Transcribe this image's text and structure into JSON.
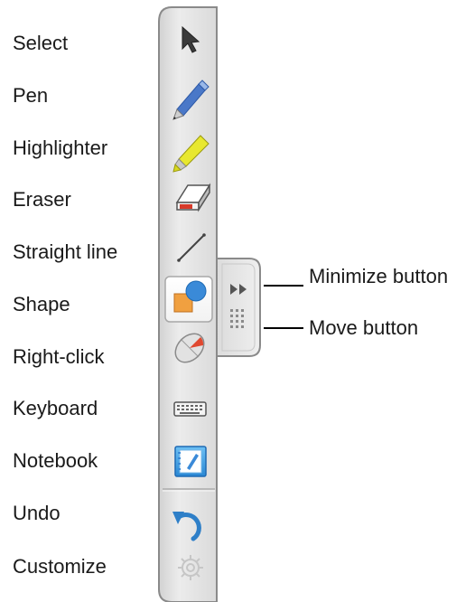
{
  "toolbar": {
    "tools": [
      {
        "label": "Select",
        "icon": "arrow-cursor-icon"
      },
      {
        "label": "Pen",
        "icon": "pen-icon"
      },
      {
        "label": "Highlighter",
        "icon": "highlighter-icon"
      },
      {
        "label": "Eraser",
        "icon": "eraser-icon"
      },
      {
        "label": "Straight line",
        "icon": "line-icon"
      },
      {
        "label": "Shape",
        "icon": "shape-icon",
        "selected": true
      },
      {
        "label": "Right-click",
        "icon": "mouse-icon"
      },
      {
        "label": "Keyboard",
        "icon": "keyboard-icon"
      },
      {
        "label": "Notebook",
        "icon": "notebook-icon"
      },
      {
        "label": "Undo",
        "icon": "undo-icon"
      },
      {
        "label": "Customize",
        "icon": "gear-icon"
      }
    ],
    "side_tab": {
      "minimize_icon": "double-chevron-right-icon",
      "move_icon": "grip-dots-icon"
    }
  },
  "callouts": {
    "minimize": "Minimize button",
    "move": "Move button"
  },
  "colors": {
    "toolbar_bg": "#e4e4e4",
    "toolbar_border": "#8a8a8a",
    "pen_blue": "#4a78c8",
    "highlighter_yellow": "#e8e830",
    "shape_orange": "#f0a040",
    "shape_blue": "#3a8ad8",
    "mouse_red": "#e04830",
    "notebook_blue": "#3a9ae0",
    "undo_blue": "#2e7fc8"
  }
}
